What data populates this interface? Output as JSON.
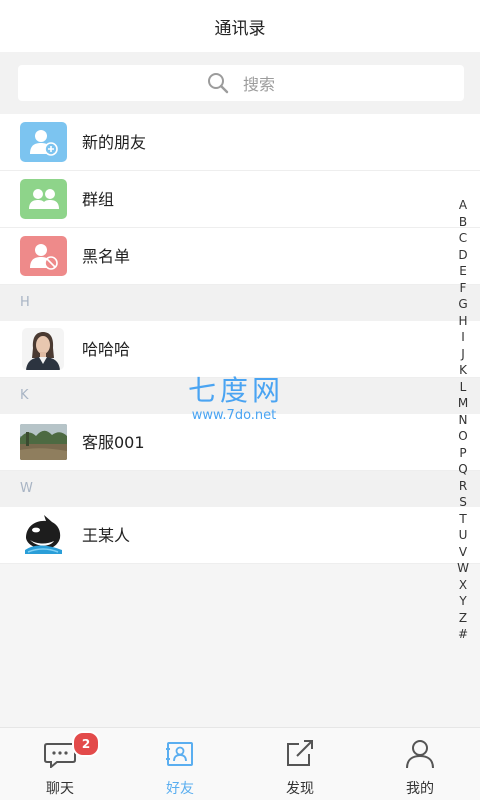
{
  "header": {
    "title": "通讯录"
  },
  "search": {
    "placeholder": "搜索"
  },
  "special_rows": [
    {
      "label": "新的朋友",
      "icon": "add-friend-icon",
      "color": "#7cc4f0"
    },
    {
      "label": "群组",
      "icon": "group-icon",
      "color": "#8ed48a"
    },
    {
      "label": "黑名单",
      "icon": "blacklist-icon",
      "color": "#ee8a8a"
    }
  ],
  "sections": [
    {
      "letter": "H",
      "contacts": [
        {
          "name": "哈哈哈",
          "avatar": "woman-portrait-avatar"
        }
      ]
    },
    {
      "letter": "K",
      "contacts": [
        {
          "name": "客服001",
          "avatar": "landscape-avatar"
        }
      ]
    },
    {
      "letter": "W",
      "contacts": [
        {
          "name": "王某人",
          "avatar": "orca-avatar"
        }
      ]
    }
  ],
  "index_letters": [
    "A",
    "B",
    "C",
    "D",
    "E",
    "F",
    "G",
    "H",
    "I",
    "J",
    "K",
    "L",
    "M",
    "N",
    "O",
    "P",
    "Q",
    "R",
    "S",
    "T",
    "U",
    "V",
    "W",
    "X",
    "Y",
    "Z",
    "#"
  ],
  "watermark": {
    "title": "七度网",
    "url": "www.7do.net"
  },
  "tabbar": {
    "tabs": [
      {
        "label": "聊天",
        "icon": "chat-icon",
        "badge": "2"
      },
      {
        "label": "好友",
        "icon": "contacts-book-icon",
        "active": true
      },
      {
        "label": "发现",
        "icon": "discover-share-icon"
      },
      {
        "label": "我的",
        "icon": "profile-icon"
      }
    ]
  },
  "colors": {
    "accent": "#5aaef0",
    "badge": "#e34b4b",
    "section_text": "#a8b4c4"
  }
}
